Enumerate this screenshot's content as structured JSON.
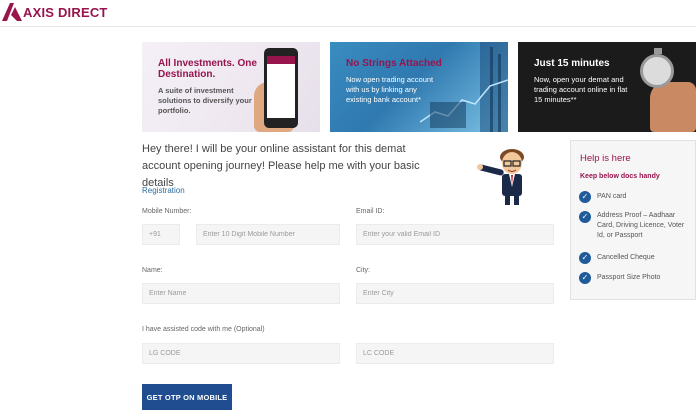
{
  "brand": {
    "name": "AXIS DIRECT",
    "color": "#97144d"
  },
  "banners": [
    {
      "title": "All Investments. One Destination.",
      "text": "A suite of investment solutions to diversify your portfolio."
    },
    {
      "title": "No Strings Attached",
      "text": "Now open trading account with us by linking any existing bank account*"
    },
    {
      "title": "Just 15 minutes",
      "text": "Now, open your demat and trading account online in flat 15 minutes**"
    }
  ],
  "intro": "Hey there! I will be your online assistant for this demat account opening journey! Please help me with your basic details",
  "form": {
    "section": "Registration",
    "mobile_label": "Mobile Number:",
    "country_code": "+91",
    "mobile_placeholder": "Enter 10 Digit Mobile Number",
    "email_label": "Email ID:",
    "email_placeholder": "Enter your valid Email ID",
    "name_label": "Name:",
    "name_placeholder": "Enter Name",
    "city_label": "City:",
    "city_placeholder": "Enter City",
    "assisted_label": "I have assisted code with me (Optional)",
    "lg_placeholder": "LG CODE",
    "lc_placeholder": "LC CODE",
    "submit_label": "GET OTP ON MOBILE",
    "submit_color": "#1f4d8f"
  },
  "help": {
    "title": "Help is here",
    "subtitle": "Keep below docs handy",
    "docs": [
      "PAN card",
      "Address Proof – Aadhaar Card, Driving Licence, Voter Id, or Passport",
      "Cancelled Cheque",
      "Passport Size Photo"
    ]
  }
}
